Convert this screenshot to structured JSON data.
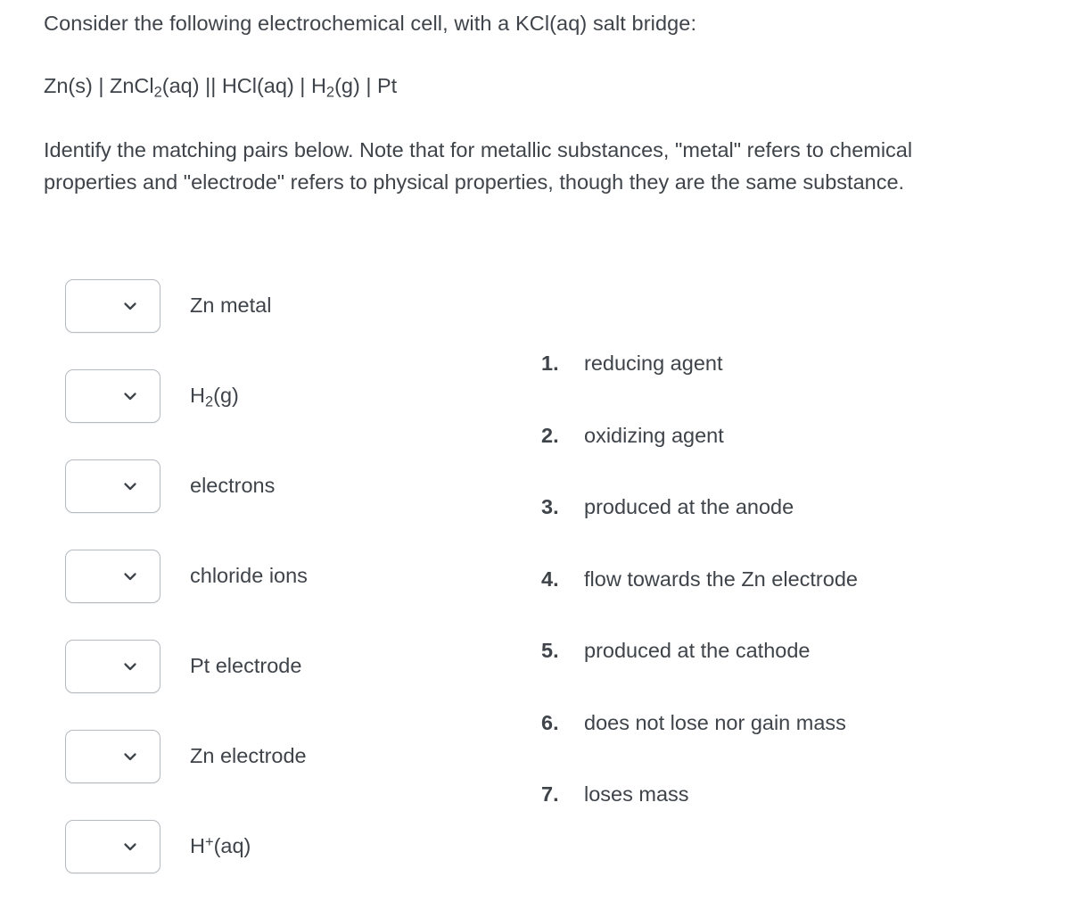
{
  "question": {
    "intro": "Consider the following electrochemical cell, with a KCl(aq) salt bridge:",
    "cell_notation": {
      "part1": "Zn(s) | ZnCl",
      "sub1": "2",
      "part2": "(aq) || HCl(aq) | H",
      "sub2": "2",
      "part3": "(g) | Pt"
    },
    "instructions": "Identify the matching pairs below. Note that for metallic substances, \"metal\" refers to chemical properties and \"electrode\" refers to physical properties, though they are the same substance."
  },
  "match_items": [
    {
      "label": "Zn metal",
      "selected": ""
    },
    {
      "label_html_pre": "H",
      "label_sub": "2",
      "label_html_post": "(g)",
      "label": "H2(g)",
      "selected": ""
    },
    {
      "label": "electrons",
      "selected": ""
    },
    {
      "label": "chloride ions",
      "selected": ""
    },
    {
      "label": "Pt electrode",
      "selected": ""
    },
    {
      "label": "Zn electrode",
      "selected": ""
    },
    {
      "label_html_pre": "H",
      "label_sup": "+",
      "label_html_post": "(aq)",
      "label": "H+(aq)",
      "selected": ""
    }
  ],
  "answers": [
    {
      "number": "1.",
      "text": "reducing agent"
    },
    {
      "number": "2.",
      "text": "oxidizing agent"
    },
    {
      "number": "3.",
      "text": "produced at the anode"
    },
    {
      "number": "4.",
      "text": "flow towards the Zn electrode"
    },
    {
      "number": "5.",
      "text": "produced at the cathode"
    },
    {
      "number": "6.",
      "text": "does not lose nor gain mass"
    },
    {
      "number": "7.",
      "text": "loses mass"
    }
  ],
  "icons": {
    "dropdown_chevron": "chevron-down-icon"
  },
  "colors": {
    "text": "#3f444a",
    "border": "#b6bbc0",
    "background": "#ffffff"
  }
}
